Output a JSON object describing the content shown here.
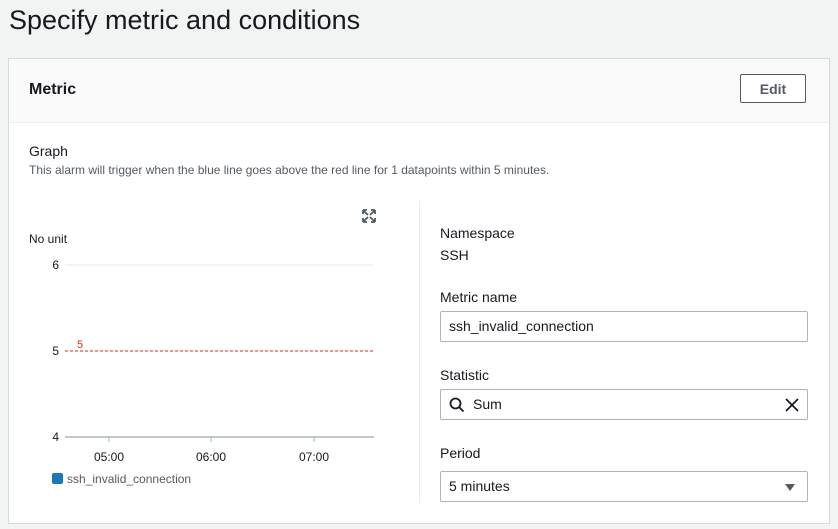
{
  "page": {
    "title": "Specify metric and conditions"
  },
  "panel": {
    "title": "Metric",
    "edit_label": "Edit",
    "graph": {
      "label": "Graph",
      "description": "This alarm will trigger when the blue line goes above the red line for 1 datapoints within 5 minutes.",
      "expand_icon": "expand-icon"
    },
    "fields": {
      "namespace_label": "Namespace",
      "namespace_value": "SSH",
      "metric_name_label": "Metric name",
      "metric_name_value": "ssh_invalid_connection",
      "statistic_label": "Statistic",
      "statistic_value": "Sum",
      "period_label": "Period",
      "period_value": "5 minutes"
    }
  },
  "colors": {
    "series": "#1f77b4",
    "threshold": "#d13212",
    "grid": "#eaeded",
    "axis": "#aab7b8"
  },
  "chart_data": {
    "type": "line",
    "ylabel": "No unit",
    "ylim": [
      4,
      6
    ],
    "yticks": [
      "6",
      "5",
      "4"
    ],
    "xticks": [
      "05:00",
      "06:00",
      "07:00"
    ],
    "series": [
      {
        "name": "ssh_invalid_connection",
        "values": []
      }
    ],
    "threshold": {
      "value": 5,
      "label": "5"
    }
  }
}
